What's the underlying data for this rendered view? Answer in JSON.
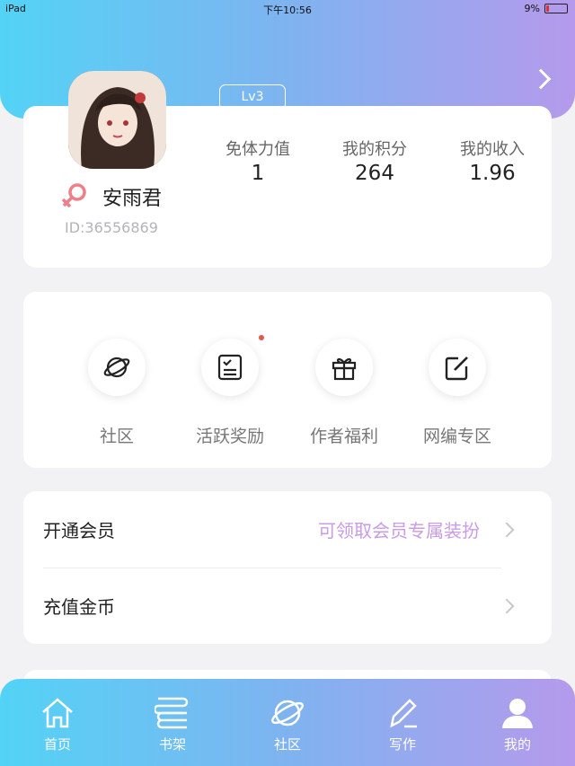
{
  "status_bar": {
    "device": "iPad",
    "time": "下午10:56",
    "battery": "9%",
    "battery_level": 0.09,
    "battery_color": "#e03030"
  },
  "profile": {
    "level": "Lv3",
    "name": "安雨君",
    "id": "ID:36556869",
    "stats": [
      {
        "label": "免体力值",
        "value": "1"
      },
      {
        "label": "我的积分",
        "value": "264"
      },
      {
        "label": "我的收入",
        "value": "1.96"
      }
    ]
  },
  "quick_actions": [
    {
      "label": "社区",
      "icon": "planet-icon"
    },
    {
      "label": "活跃奖励",
      "icon": "checklist-icon",
      "has_notification": true
    },
    {
      "label": "作者福利",
      "icon": "gift-icon"
    },
    {
      "label": "网编专区",
      "icon": "edit-icon"
    }
  ],
  "menu": [
    {
      "title": "开通会员",
      "hint": "可领取会员专属装扮"
    },
    {
      "title": "充值金币",
      "hint": ""
    }
  ],
  "tabs": [
    {
      "label": "首页",
      "icon": "home-icon"
    },
    {
      "label": "书架",
      "icon": "bookshelf-icon"
    },
    {
      "label": "社区",
      "icon": "planet-icon"
    },
    {
      "label": "写作",
      "icon": "pen-icon"
    },
    {
      "label": "我的",
      "icon": "user-icon",
      "active": true
    }
  ],
  "colors": {
    "gradient_start": "#53d3f6",
    "gradient_end": "#b59aec",
    "accent_hint": "#c99be8",
    "gender_female": "#ee7f8a"
  }
}
